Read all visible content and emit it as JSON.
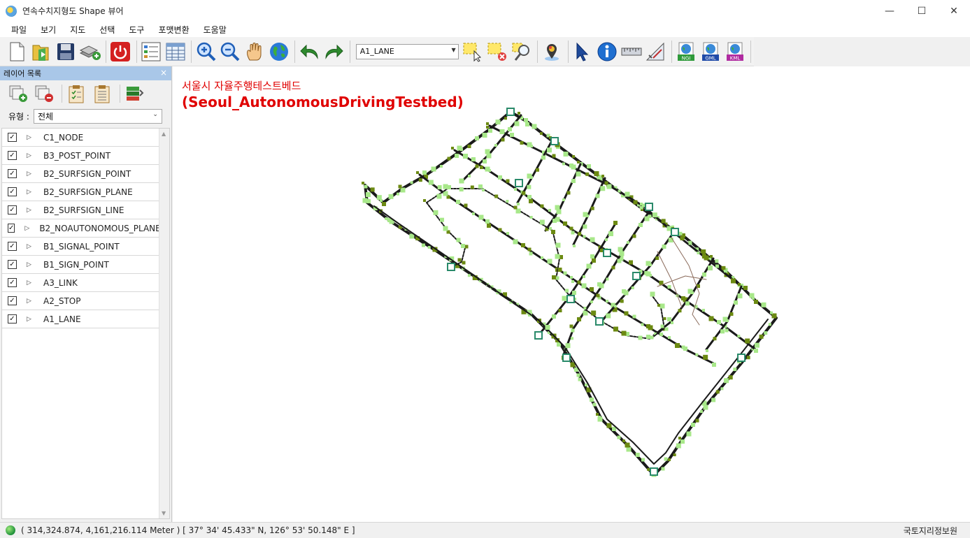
{
  "window": {
    "title": "연속수치지형도 Shape 뷰어",
    "minimize": "—",
    "maximize": "☐",
    "close": "✕"
  },
  "menu": [
    "파일",
    "보기",
    "지도",
    "선택",
    "도구",
    "포맷변환",
    "도움말"
  ],
  "toolbar": {
    "layer_select_value": "A1_LANE",
    "export_labels": [
      "NGI",
      "GML",
      "KML"
    ]
  },
  "layer_panel": {
    "title": "레이어 목록",
    "close": "×",
    "filter_label": "유형 :",
    "filter_value": "전체",
    "layers": [
      {
        "name": "C1_NODE",
        "checked": true
      },
      {
        "name": "B3_POST_POINT",
        "checked": true
      },
      {
        "name": "B2_SURFSIGN_POINT",
        "checked": true
      },
      {
        "name": "B2_SURFSIGN_PLANE",
        "checked": true
      },
      {
        "name": "B2_SURFSIGN_LINE",
        "checked": true
      },
      {
        "name": "B2_NOAUTONOMOUS_PLANE",
        "checked": true
      },
      {
        "name": "B1_SIGNAL_POINT",
        "checked": true
      },
      {
        "name": "B1_SIGN_POINT",
        "checked": true
      },
      {
        "name": "A3_LINK",
        "checked": true
      },
      {
        "name": "A2_STOP",
        "checked": true
      },
      {
        "name": "A1_LANE",
        "checked": true
      }
    ]
  },
  "map": {
    "title_ko": "서울시 자율주행테스트베드",
    "title_en": "(Seoul_AutonomousDrivingTestbed)",
    "colors": {
      "title": "#e00000",
      "road": "#1a1a1a",
      "marker": "#a8e88a",
      "marker_dark": "#6c8a12"
    }
  },
  "status": {
    "coords": "( 314,324.874, 4,161,216.114 Meter ) [ 37° 34' 45.433\" N, 126° 53' 50.148\" E ]",
    "org": "국토지리정보원"
  }
}
